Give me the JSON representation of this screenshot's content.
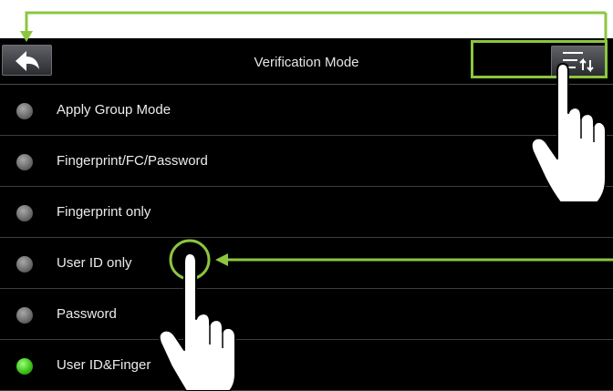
{
  "header": {
    "title": "Verification Mode",
    "back_icon": "back-arrow-icon",
    "menu_icon": "sort-menu-icon"
  },
  "list": {
    "items": [
      {
        "label": "Apply Group Mode",
        "selected": false
      },
      {
        "label": "Fingerprint/FC/Password",
        "selected": false
      },
      {
        "label": "Fingerprint only",
        "selected": false
      },
      {
        "label": "User ID only",
        "selected": false
      },
      {
        "label": "Password",
        "selected": false
      },
      {
        "label": "User ID&Finger",
        "selected": true
      }
    ]
  },
  "annotations": {
    "highlight_color": "#8cc63f",
    "hand_icon": "pointing-hand-icon"
  },
  "colors": {
    "background": "#000000",
    "text": "#ececec",
    "selected_radio": "#3ec21a"
  }
}
